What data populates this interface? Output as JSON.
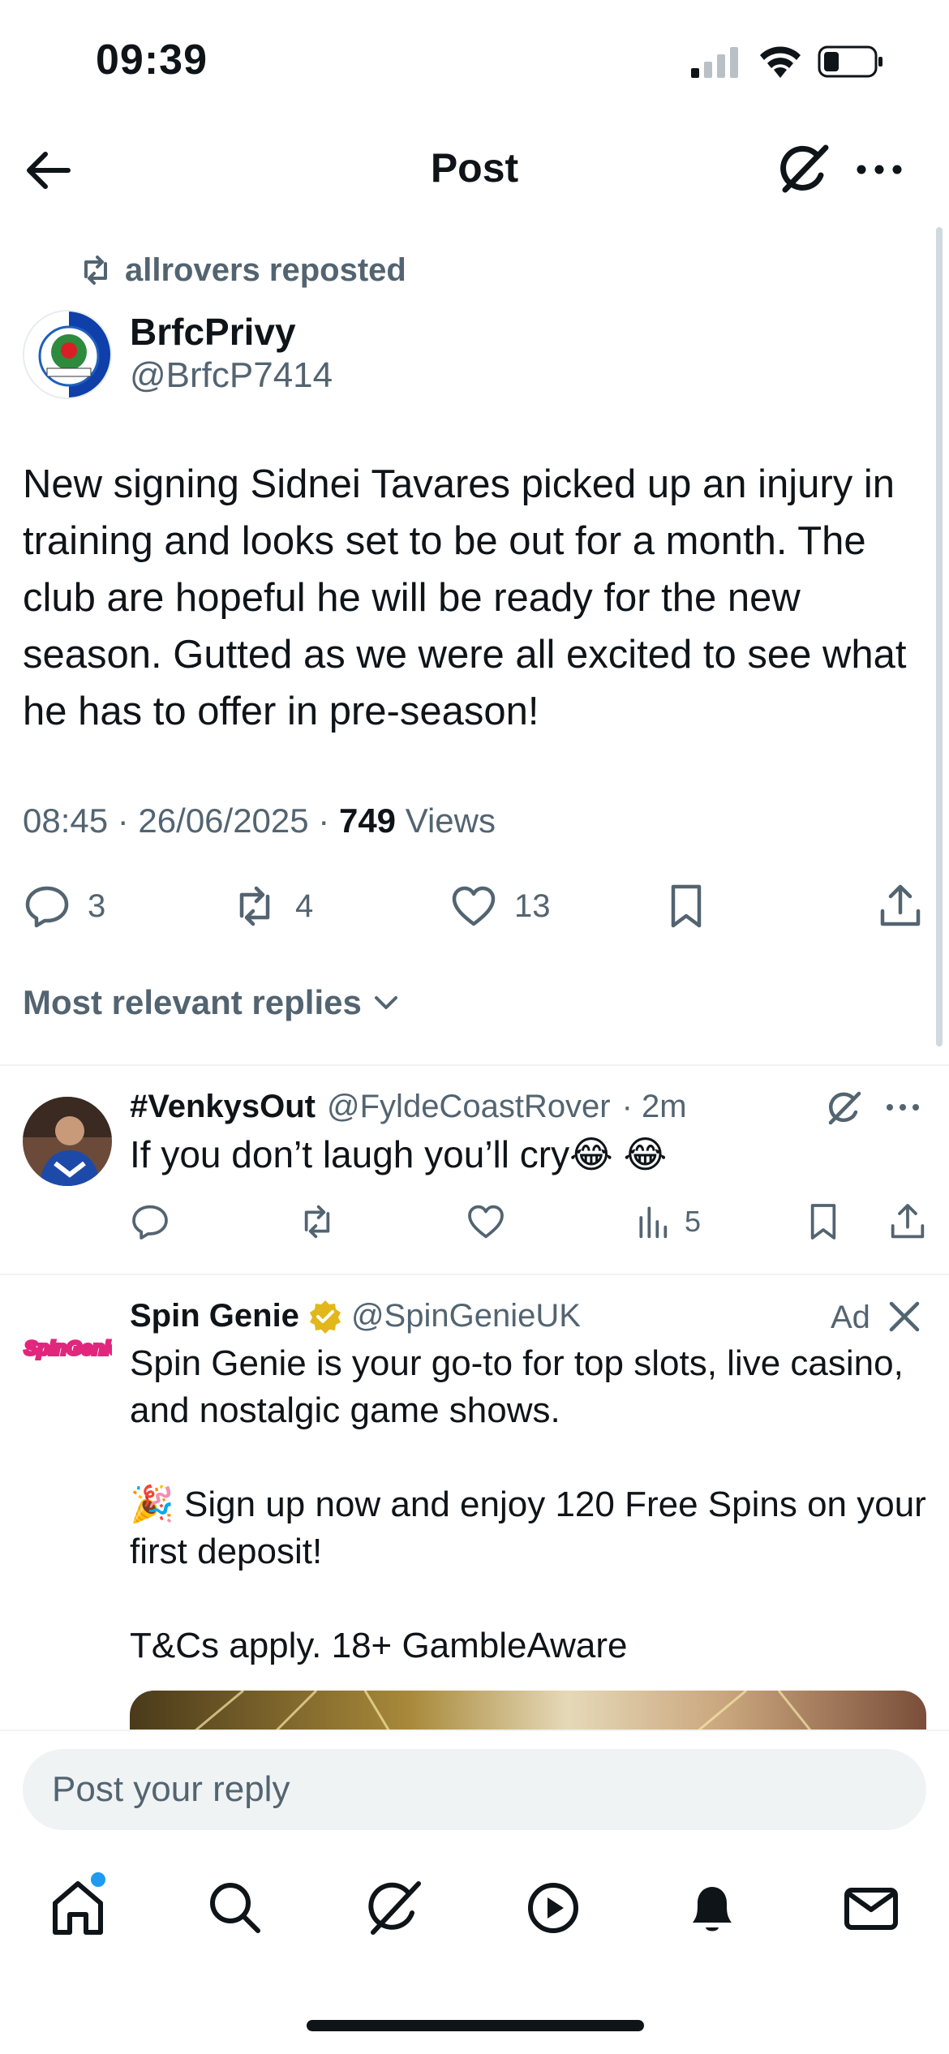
{
  "status_bar": {
    "time": "09:39"
  },
  "header": {
    "title": "Post"
  },
  "repost": {
    "text": "allrovers reposted"
  },
  "tweet": {
    "author_name": "BrfcPrivy",
    "author_handle": "@BrfcP7414",
    "text": "New signing Sidnei Tavares picked up an injury in training and looks set to be out for a month. The club are hopeful he will be ready for the new season. Gutted as we were all excited to see what he has to offer in pre-season!",
    "timestamp": "08:45 · 26/06/2025 · ",
    "views_count": "749",
    "views_label": " Views",
    "replies": "3",
    "reposts": "4",
    "likes": "13"
  },
  "sort_label": "Most relevant replies",
  "reply": {
    "name": "#VenkysOut",
    "handle": "@FyldeCoastRover",
    "time": "· 2m",
    "text": "If you don’t laugh you’ll cry😂 😂",
    "views": "5"
  },
  "ad": {
    "name": "Spin Genie",
    "handle": "@SpinGenieUK",
    "label": "Ad",
    "logo_text": "SpinGenie",
    "paragraphs": [
      "Spin Genie is your go-to for top slots, live casino, and nostalgic game shows.",
      "🎉 Sign up now and enjoy 120 Free Spins on your first deposit!",
      "T&Cs apply. 18+ GambleAware"
    ]
  },
  "reply_input": {
    "placeholder": "Post your reply"
  },
  "colors": {
    "secondary_text": "#536471",
    "accent_blue": "#1d9bf0",
    "verified_gold": "#e2b719",
    "ad_logo": "#e0267d"
  }
}
